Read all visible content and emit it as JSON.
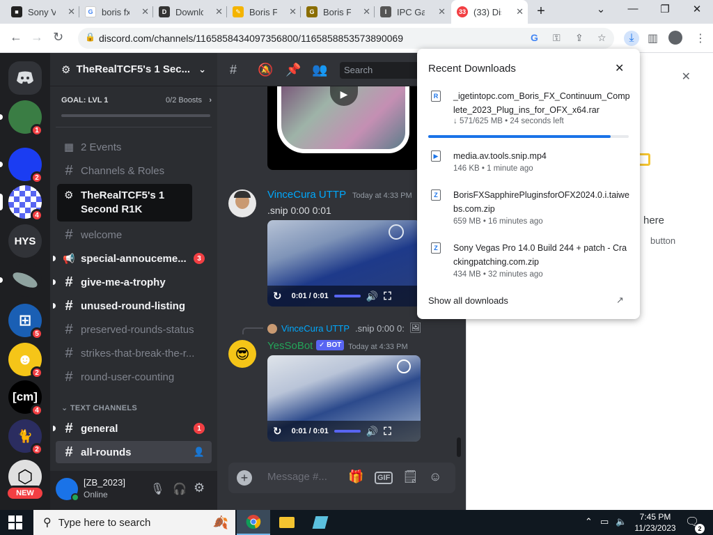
{
  "browser": {
    "tabs": [
      {
        "label": "Sony Ve",
        "favicon": "media-icon",
        "color": "#222"
      },
      {
        "label": "boris fx",
        "favicon": "google-icon",
        "color": "#4285f4"
      },
      {
        "label": "Downlo",
        "favicon": "download-site-icon",
        "color": "#333"
      },
      {
        "label": "Boris FX",
        "favicon": "borisfx-icon",
        "color": "#f4b400"
      },
      {
        "label": "Boris FX",
        "favicon": "g-site-icon",
        "color": "#8a6d00"
      },
      {
        "label": "IPC Gam",
        "favicon": "ipc-icon",
        "color": "#555"
      },
      {
        "label": "(33) Dis",
        "favicon": "discord-icon",
        "color": "#f23f43",
        "active": true
      }
    ],
    "new_tab": "+",
    "url": "discord.com/channels/1165858434097356800/1165858853573890069"
  },
  "discord": {
    "server_name": "TheRealTCF5's 1 Sec...",
    "goal_label": "GOAL: LVL 1",
    "goal_boosts": "0/2 Boosts",
    "guilds": [
      {
        "name": "turtle-server",
        "text": "",
        "color": "#3a7d44",
        "badge": "1"
      },
      {
        "name": "blue-server",
        "text": "",
        "color": "#1b3df2",
        "badge": "2"
      },
      {
        "name": "checker-server",
        "text": "",
        "color": "#5865f2",
        "badge": "4"
      },
      {
        "name": "hys-server",
        "text": "HYS",
        "color": "#313338",
        "badge": ""
      },
      {
        "name": "fish-server",
        "text": "",
        "color": "#8fa3a0",
        "badge": ""
      },
      {
        "name": "windows-server",
        "text": "",
        "color": "#1a5fb4",
        "badge": "5"
      },
      {
        "name": "emoji-server",
        "text": "",
        "color": "#f5c518",
        "badge": "2"
      },
      {
        "name": "cm-server",
        "text": "[cm]",
        "color": "#000000",
        "badge": "4"
      },
      {
        "name": "cat-server",
        "text": "",
        "color": "#2b2d60",
        "badge": "2"
      },
      {
        "name": "hex-server",
        "text": "",
        "color": "#e0e0e0",
        "badge": ""
      }
    ],
    "new_label": "NEW",
    "tooltip": "TheRealTCF5's 1 Second R1K",
    "menu": [
      {
        "label": "2 Events",
        "icon": "calendar-icon"
      },
      {
        "label": "Channels & Roles",
        "icon": "channels-roles-icon"
      }
    ],
    "channels": [
      {
        "label": "welcome",
        "unread": false,
        "badge": ""
      },
      {
        "label": "special-annouceme...",
        "unread": true,
        "badge": "3",
        "icon": "megaphone-icon"
      },
      {
        "label": "give-me-a-trophy",
        "unread": true,
        "badge": ""
      },
      {
        "label": "unused-round-listing",
        "unread": true,
        "badge": ""
      },
      {
        "label": "preserved-rounds-status",
        "unread": false,
        "badge": ""
      },
      {
        "label": "strikes-that-break-the-r...",
        "unread": false,
        "badge": ""
      },
      {
        "label": "round-user-counting",
        "unread": false,
        "badge": ""
      }
    ],
    "category": "TEXT CHANNELS",
    "text_channels": [
      {
        "label": "general",
        "unread": true,
        "badge": "1"
      },
      {
        "label": "all-rounds",
        "active": true,
        "badge": ""
      }
    ],
    "user": {
      "name": "[ZB_2023]",
      "status": "Online"
    },
    "search_placeholder": "Search",
    "messages": [
      {
        "author": "VinceCura UTTP",
        "author_color": "#00a8fc",
        "time": "Today at 4:33 PM",
        "text": ".snip 0:00 0:01",
        "video_time": "0:01 / 0:01"
      },
      {
        "reply_author": "VinceCura UTTP",
        "reply_text": ".snip 0:00 0:",
        "author": "YesSoBot",
        "bot_tag": "BOT",
        "author_color": "#23a559",
        "time": "Today at 4:33 PM",
        "video_time": "0:01 / 0:01"
      }
    ],
    "input_placeholder": "Message #..."
  },
  "right_panel": {
    "text1": "here",
    "text2": "button"
  },
  "downloads": {
    "title": "Recent Downloads",
    "items": [
      {
        "name": "_igetintopc.com_Boris_FX_Continuum_Complete_2023_Plug_ins_for_OFX_x64.rar",
        "status": "↓ 571/625 MB • 24 seconds left",
        "progress": 0.91,
        "icon": "R"
      },
      {
        "name": "media.av.tools.snip.mp4",
        "status": "146 KB • 1 minute ago",
        "icon": "▶"
      },
      {
        "name": "BorisFXSapphirePluginsforOFX2024.0.i.taiwebs.com.zip",
        "status": "659 MB • 16 minutes ago",
        "icon": "Z"
      },
      {
        "name": "Sony Vegas Pro 14.0 Build 244 + patch - Crackingpatching.com.zip",
        "status": "434 MB • 32 minutes ago",
        "icon": "Z"
      }
    ],
    "show_all": "Show all downloads"
  },
  "taskbar": {
    "search_placeholder": "Type here to search",
    "time": "7:45 PM",
    "date": "11/23/2023",
    "notifications": "2"
  }
}
